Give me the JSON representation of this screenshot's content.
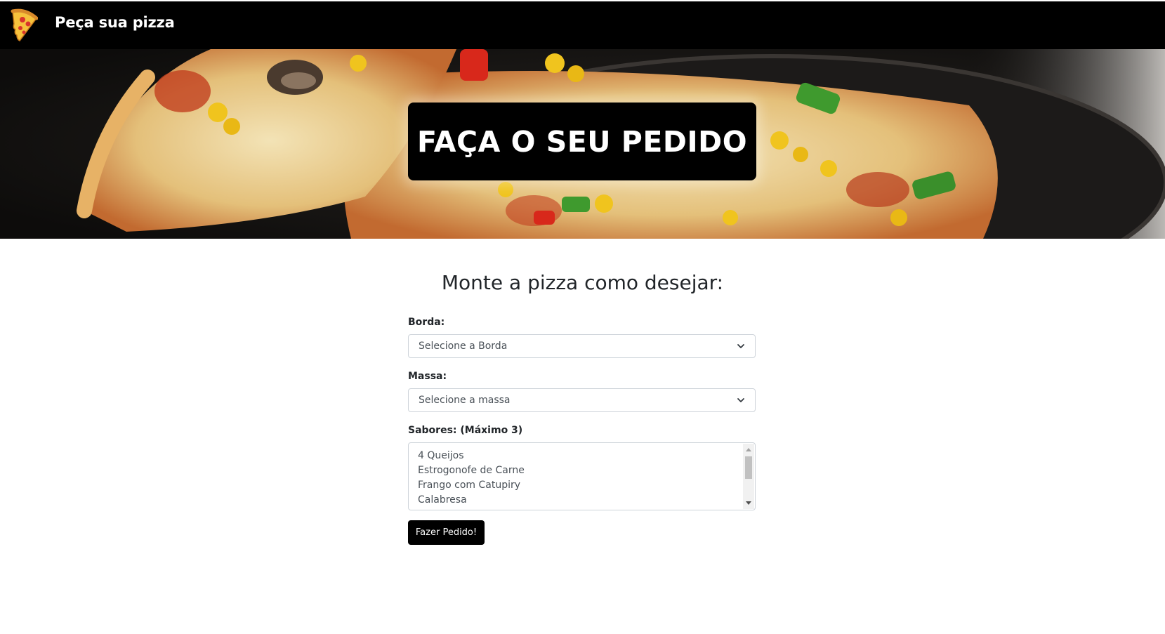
{
  "navbar": {
    "brand_title": "Peça sua pizza",
    "logo_icon": "pizza-slice-icon"
  },
  "hero": {
    "title": "FAÇA O SEU PEDIDO",
    "background": "pizza-photo"
  },
  "form": {
    "heading": "Monte a pizza como desejar:",
    "borda": {
      "label": "Borda:",
      "selected": "Selecione a Borda"
    },
    "massa": {
      "label": "Massa:",
      "selected": "Selecione a massa"
    },
    "sabores": {
      "label": "Sabores: (Máximo 3)",
      "options": [
        "4 Queijos",
        "Estrogonofe de Carne",
        "Frango com Catupiry",
        "Calabresa"
      ]
    },
    "submit_label": "Fazer Pedido!"
  },
  "colors": {
    "navbar_bg": "#000000",
    "button_bg": "#000000",
    "text": "#212529"
  }
}
